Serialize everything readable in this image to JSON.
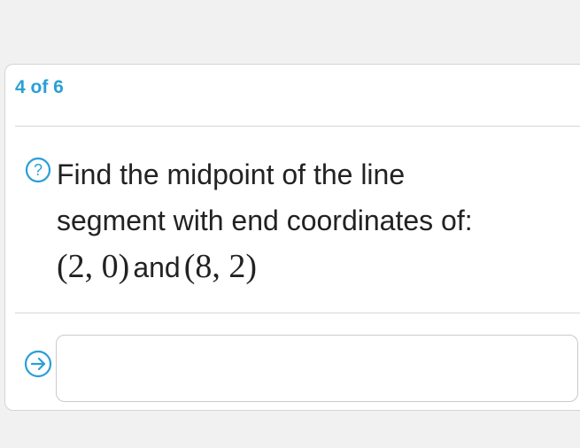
{
  "header": {
    "progress_text": "4 of 6"
  },
  "question": {
    "help_icon": "question-circle-icon",
    "line1": "Find the midpoint of the line",
    "line2": "segment with end coordinates of:",
    "point1": "(2, 0)",
    "conjunction": "and",
    "point2": "(8, 2)"
  },
  "answer": {
    "submit_icon": "arrow-right-circle-icon",
    "value": "",
    "placeholder": ""
  },
  "colors": {
    "accent": "#2a9fd6",
    "text": "#222222",
    "background": "#f1f1f1",
    "card": "#ffffff"
  }
}
